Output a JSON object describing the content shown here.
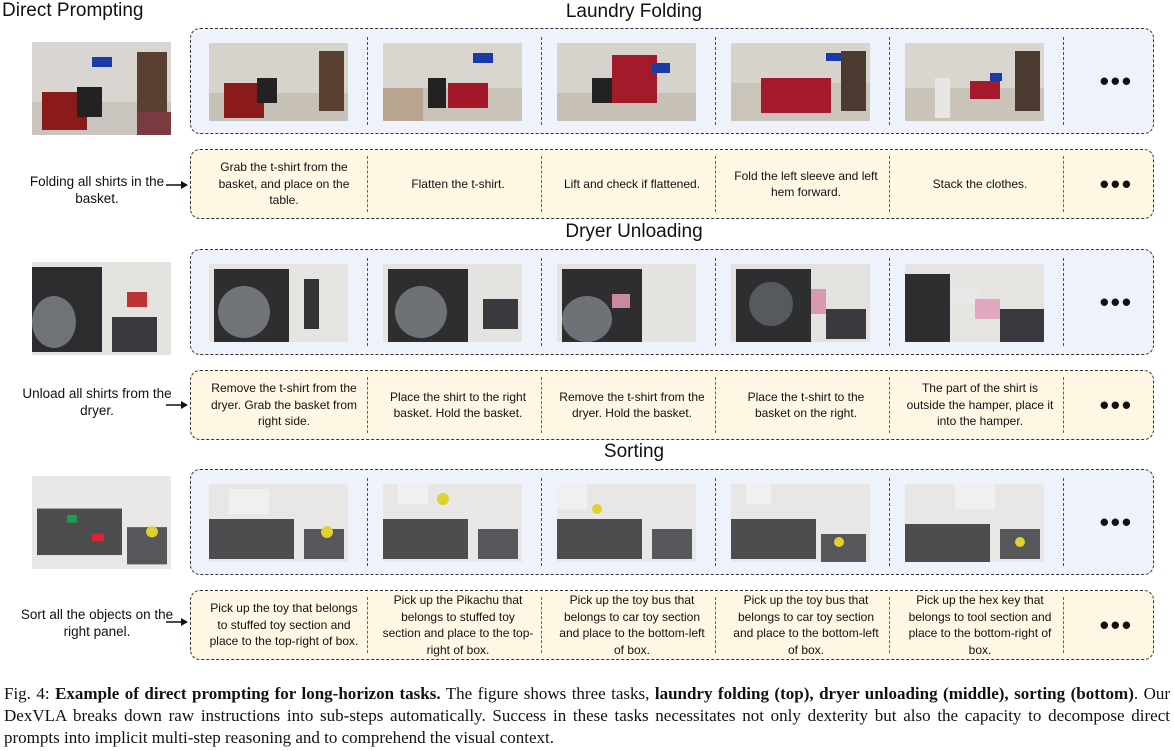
{
  "header_left": "Direct Prompting",
  "sections": [
    {
      "title": "Laundry Folding",
      "prompt": "Folding all shirts in the basket.",
      "steps": [
        "Grab the t-shirt  from the basket, and place on the table.",
        "Flatten the t-shirt.",
        "Lift and check if flattened.",
        "Fold the left sleeve and left hem forward.",
        "Stack the clothes."
      ],
      "ellipsis": "•••"
    },
    {
      "title": "Dryer Unloading",
      "prompt": "Unload all shirts from the dryer.",
      "steps": [
        "Remove the t-shirt from the dryer. Grab the basket from right side.",
        "Place the shirt to the right basket. Hold the basket.",
        "Remove the t-shirt from the dryer. Hold the basket.",
        "Place the t-shirt to the basket on the right.",
        "The part of the shirt is outside the hamper, place it into the hamper."
      ],
      "ellipsis": "•••"
    },
    {
      "title": "Sorting",
      "prompt": "Sort all the objects on the right panel.",
      "steps": [
        "Pick up the toy that belongs to stuffed toy section and place to the top-right of box.",
        "Pick up the Pikachu that belongs to stuffed toy section and place to the top-right of box.",
        "Pick up the toy bus that belongs to car toy section and place to the bottom-left of box.",
        "Pick up the toy bus that belongs to car toy section and place to the bottom-left of box.",
        "Pick up the hex key that belongs to tool section and place to the bottom-right of box."
      ],
      "ellipsis": "•••"
    }
  ],
  "caption": {
    "fig_label": "Fig. 4:",
    "bold_title": "Example of direct prompting for long-horizon tasks.",
    "text_1": " The figure shows three tasks, ",
    "bold_tasks": "laundry folding (top), dryer unloading (middle), sorting (bottom)",
    "text_2": ". Our DexVLA breaks down raw instructions into sub-steps automatically. Success in these tasks necessitates not only dexterity but also the capacity to decompose direct prompts into implicit multi-step reasoning and to comprehend the visual context."
  },
  "colors": {
    "image_panel_bg": "#eef3fb",
    "step_panel_bg": "#fdf7e4",
    "image_separator": "#3a4a8a",
    "step_separator": "#4a7a3a"
  }
}
